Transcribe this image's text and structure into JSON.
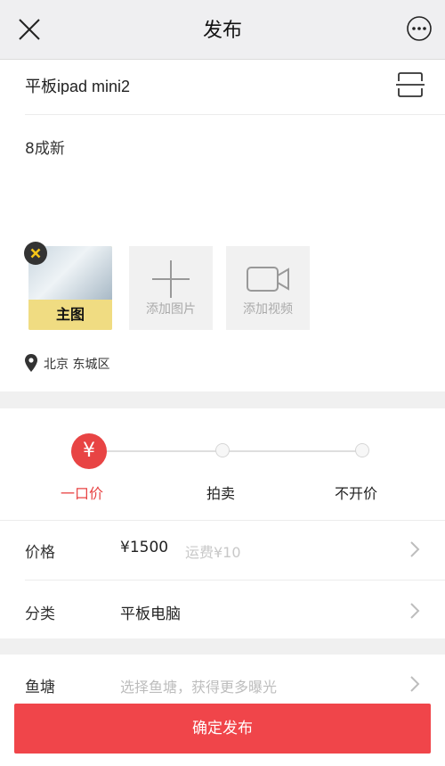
{
  "header": {
    "title": "发布",
    "close_icon": "close-icon",
    "more_icon": "more-icon"
  },
  "item": {
    "title": "平板ipad mini2",
    "description": "8成新"
  },
  "media": {
    "cover_label": "主图",
    "add_photo_label": "添加图片",
    "add_video_label": "添加视频"
  },
  "location": "北京 东城区",
  "price_types": [
    {
      "label": "一口价",
      "icon": "¥",
      "selected": true
    },
    {
      "label": "拍卖",
      "selected": false
    },
    {
      "label": "不开价",
      "selected": false
    }
  ],
  "rows": {
    "price": {
      "label": "价格",
      "value": "¥1500",
      "shipping": "运费¥10"
    },
    "category": {
      "label": "分类",
      "value": "平板电脑"
    },
    "pond": {
      "label": "鱼塘",
      "placeholder": "选择鱼塘，获得更多曝光"
    }
  },
  "publish_button": "确定发布",
  "colors": {
    "accent": "#e84444",
    "button": "#f0454a",
    "cover_banner": "#f0dc82"
  }
}
